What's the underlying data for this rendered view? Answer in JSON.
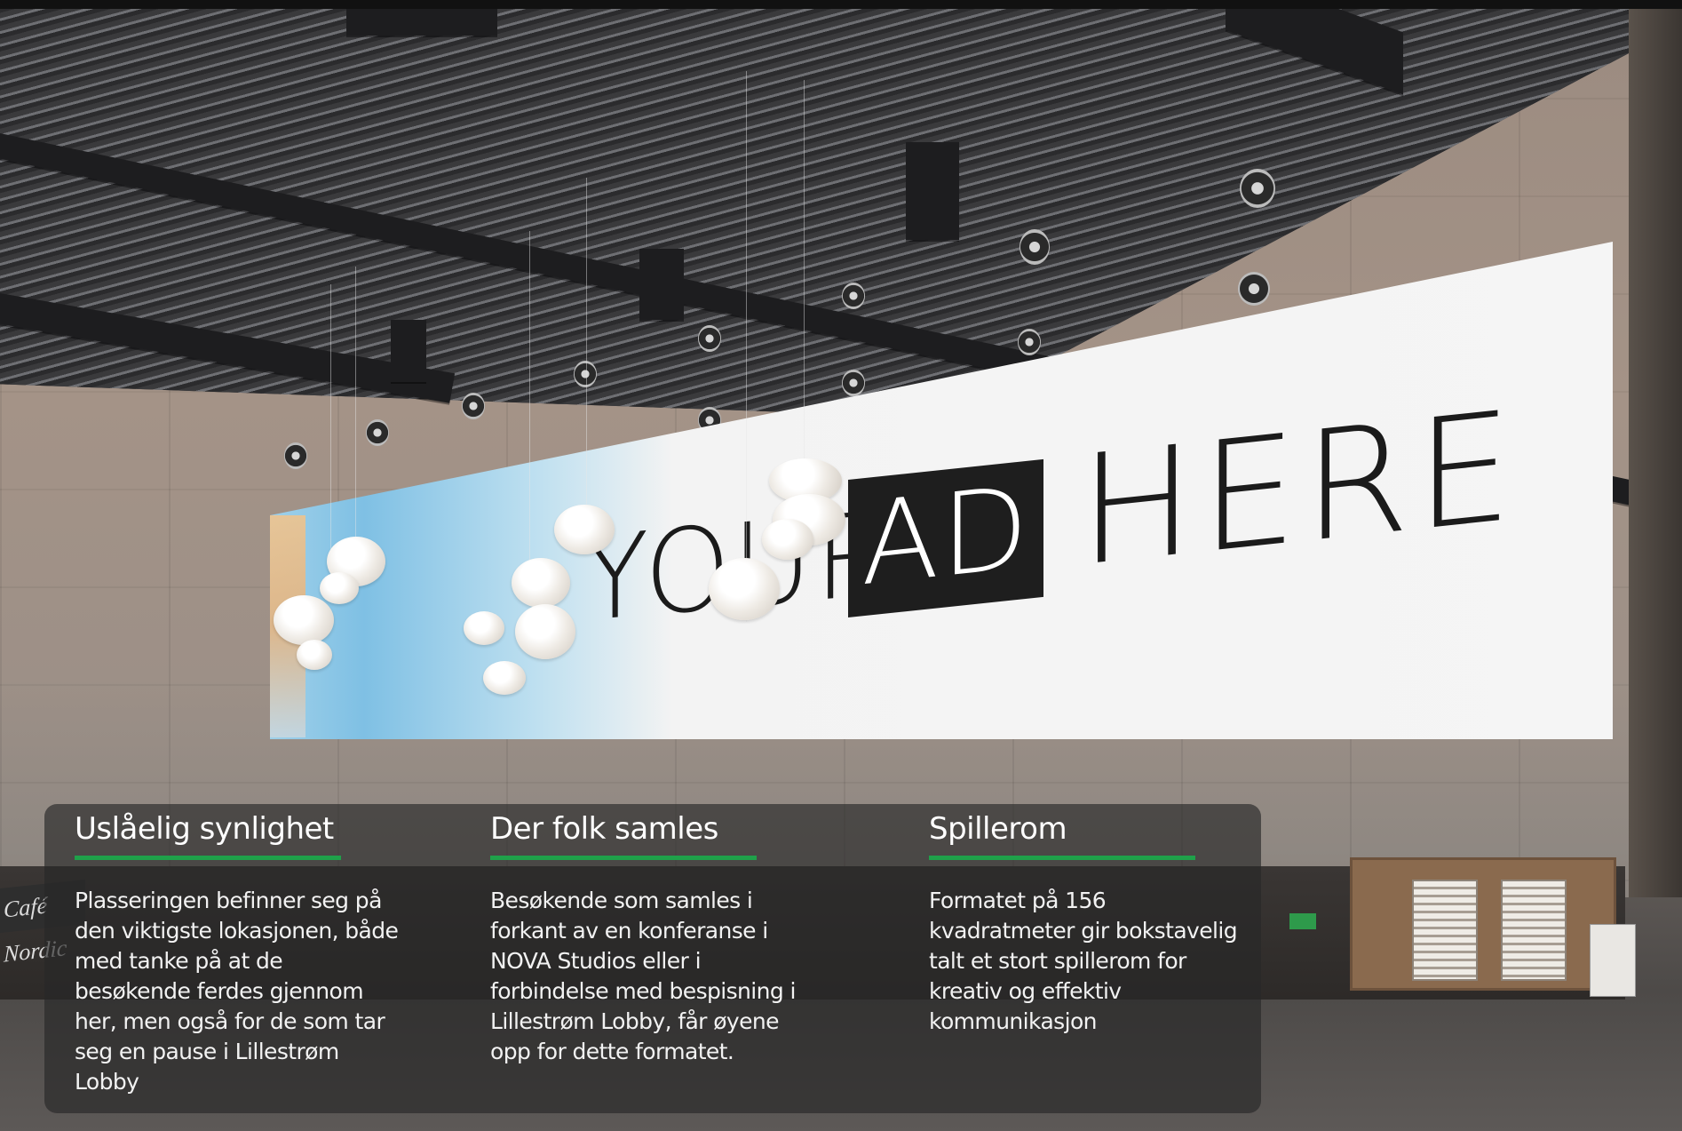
{
  "billboard": {
    "word_your": "YOUR",
    "word_ad": "AD",
    "word_here": "HERE"
  },
  "venue_sign": "Café Nordic",
  "features": [
    {
      "title": "Uslåelig synlighet",
      "text": "Plasseringen befinner seg på den viktigste lokasjonen, både med tanke på at de besøkende ferdes gjennom her, men også for de som tar seg en pause i Lillestrøm Lobby"
    },
    {
      "title": "Der folk samles",
      "text": "Besøkende som samles i forkant av en konferanse i NOVA Studios eller i forbindelse med bespisning i Lillestrøm Lobby, får øyene opp for dette formatet."
    },
    {
      "title": "Spillerom",
      "text": "Formatet på 156 kvadratmeter gir bokstavelig talt et stort spillerom for kreativ og effektiv kommunikasjon"
    }
  ],
  "colors": {
    "accent_rule": "#1fa14a",
    "panel_bg": "rgba(40,40,40,0.66)",
    "ad_box": "#1e1e1e"
  }
}
